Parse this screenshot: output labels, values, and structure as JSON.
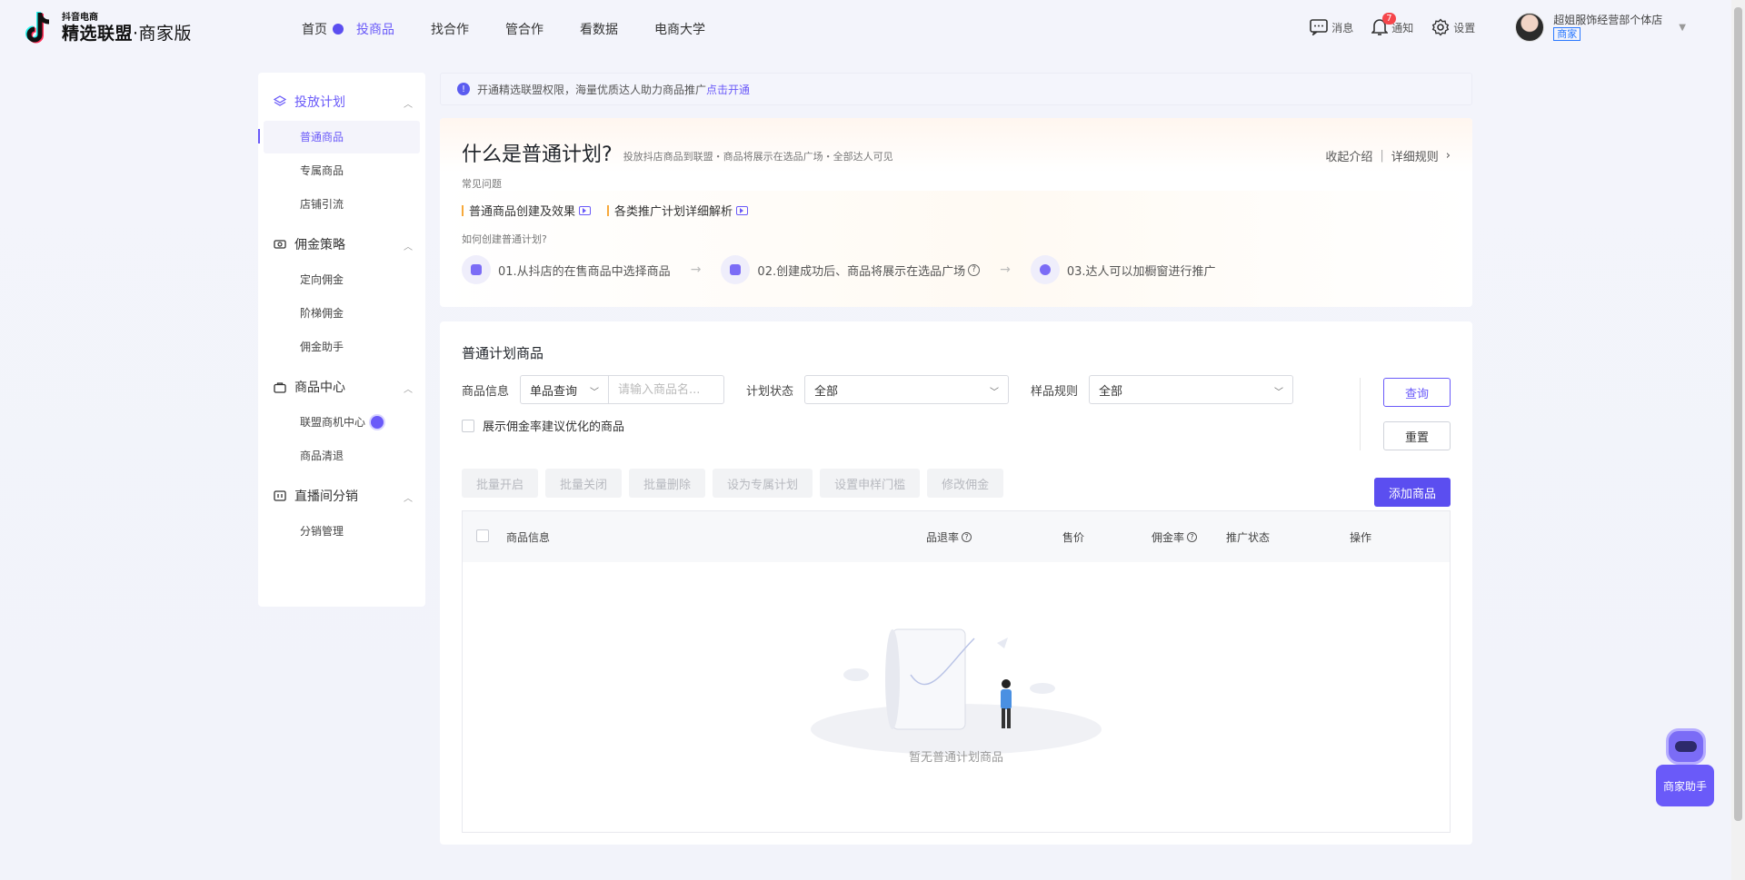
{
  "logo": {
    "small": "抖音电商",
    "big": "精选联盟",
    "sub": "·商家版"
  },
  "nav": [
    "首页",
    "投商品",
    "找合作",
    "管合作",
    "看数据",
    "电商大学"
  ],
  "top_right": {
    "message": "消息",
    "notice": "通知",
    "notice_badge": "7",
    "settings": "设置",
    "user_name": "超姐服饰经营部个体店",
    "user_tag": "商家"
  },
  "sidebar": {
    "groups": [
      {
        "title": "投放计划",
        "items": [
          "普通商品",
          "专属商品",
          "店铺引流"
        ]
      },
      {
        "title": "佣金策略",
        "items": [
          "定向佣金",
          "阶梯佣金",
          "佣金助手"
        ]
      },
      {
        "title": "商品中心",
        "items": [
          "联盟商机中心",
          "商品清退"
        ]
      },
      {
        "title": "直播间分销",
        "items": [
          "分销管理"
        ]
      }
    ]
  },
  "notice": {
    "text": "开通精选联盟权限，海量优质达人助力商品推广",
    "link": "点击开通"
  },
  "intro": {
    "title": "什么是普通计划?",
    "desc": "投放抖店商品到联盟・商品将展示在选品广场・全部达人可见",
    "collapse": "收起介绍",
    "rules": "详细规则",
    "faq_label": "常见问题",
    "faq": [
      "普通商品创建及效果",
      "各类推广计划详细解析"
    ],
    "how_label": "如何创建普通计划?",
    "steps": [
      "01.从抖店的在售商品中选择商品",
      "02.创建成功后、商品将展示在选品广场",
      "03.达人可以加橱窗进行推广"
    ]
  },
  "products": {
    "title": "普通计划商品",
    "info_label": "商品信息",
    "query_type": "单品查询",
    "search_placeholder": "请输入商品名...",
    "status_label": "计划状态",
    "status_value": "全部",
    "sample_label": "样品规则",
    "sample_value": "全部",
    "query": "查询",
    "reset": "重置",
    "checkbox_label": "展示佣金率建议优化的商品",
    "actions": [
      "批量开启",
      "批量关闭",
      "批量删除",
      "设为专属计划",
      "设置申样门槛",
      "修改佣金"
    ],
    "add": "添加商品",
    "columns": [
      "商品信息",
      "品退率",
      "售价",
      "佣金率",
      "推广状态",
      "操作"
    ],
    "empty": "暂无普通计划商品"
  },
  "assistant": "商家助手",
  "colors": {
    "accent": "#6a5af9",
    "badge": "#f5454b"
  }
}
